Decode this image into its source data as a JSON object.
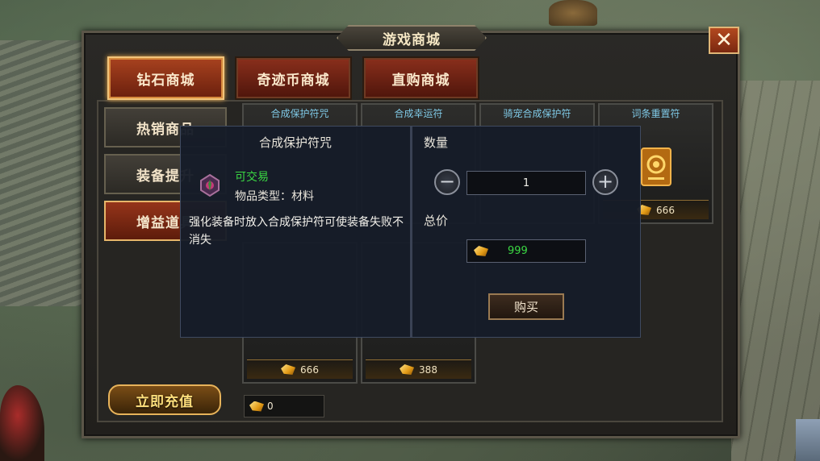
{
  "window": {
    "title": "游戏商城",
    "close_label": "✕"
  },
  "top_tabs": [
    {
      "label": "钻石商城",
      "active": true
    },
    {
      "label": "奇迹币商城",
      "active": false
    },
    {
      "label": "直购商城",
      "active": false
    }
  ],
  "side_tabs": [
    {
      "label": "热销商品",
      "active": false
    },
    {
      "label": "装备提升",
      "active": false
    },
    {
      "label": "增益道具",
      "active": true
    }
  ],
  "items": [
    {
      "name": "合成保护符咒",
      "price": "",
      "icon": "purple-charm-icon"
    },
    {
      "name": "合成幸运符",
      "price": "",
      "icon": "luck-charm-icon"
    },
    {
      "name": "骑宠合成保护符",
      "price": "",
      "icon": "pet-charm-icon"
    },
    {
      "name": "词条重置符",
      "price": "666",
      "icon": "reset-card-icon"
    },
    {
      "name": "",
      "price": "666",
      "icon": "item-icon"
    },
    {
      "name": "",
      "price": "388",
      "icon": "item-icon"
    }
  ],
  "recharge_label": "立即充值",
  "balance": "0",
  "popup": {
    "item_name": "合成保护符咒",
    "tradable": "可交易",
    "item_type": "物品类型：材料",
    "description": "强化装备时放入合成保护符可使装备失败不消失",
    "quantity_label": "数量",
    "quantity_value": "1",
    "minus_label": "−",
    "plus_label": "+",
    "total_label": "总价",
    "total_value": "999",
    "buy_label": "购买"
  },
  "colors": {
    "accent_gold": "#e7b35a",
    "tradable_green": "#3bd843",
    "item_name_blue": "#7fc9e6"
  }
}
